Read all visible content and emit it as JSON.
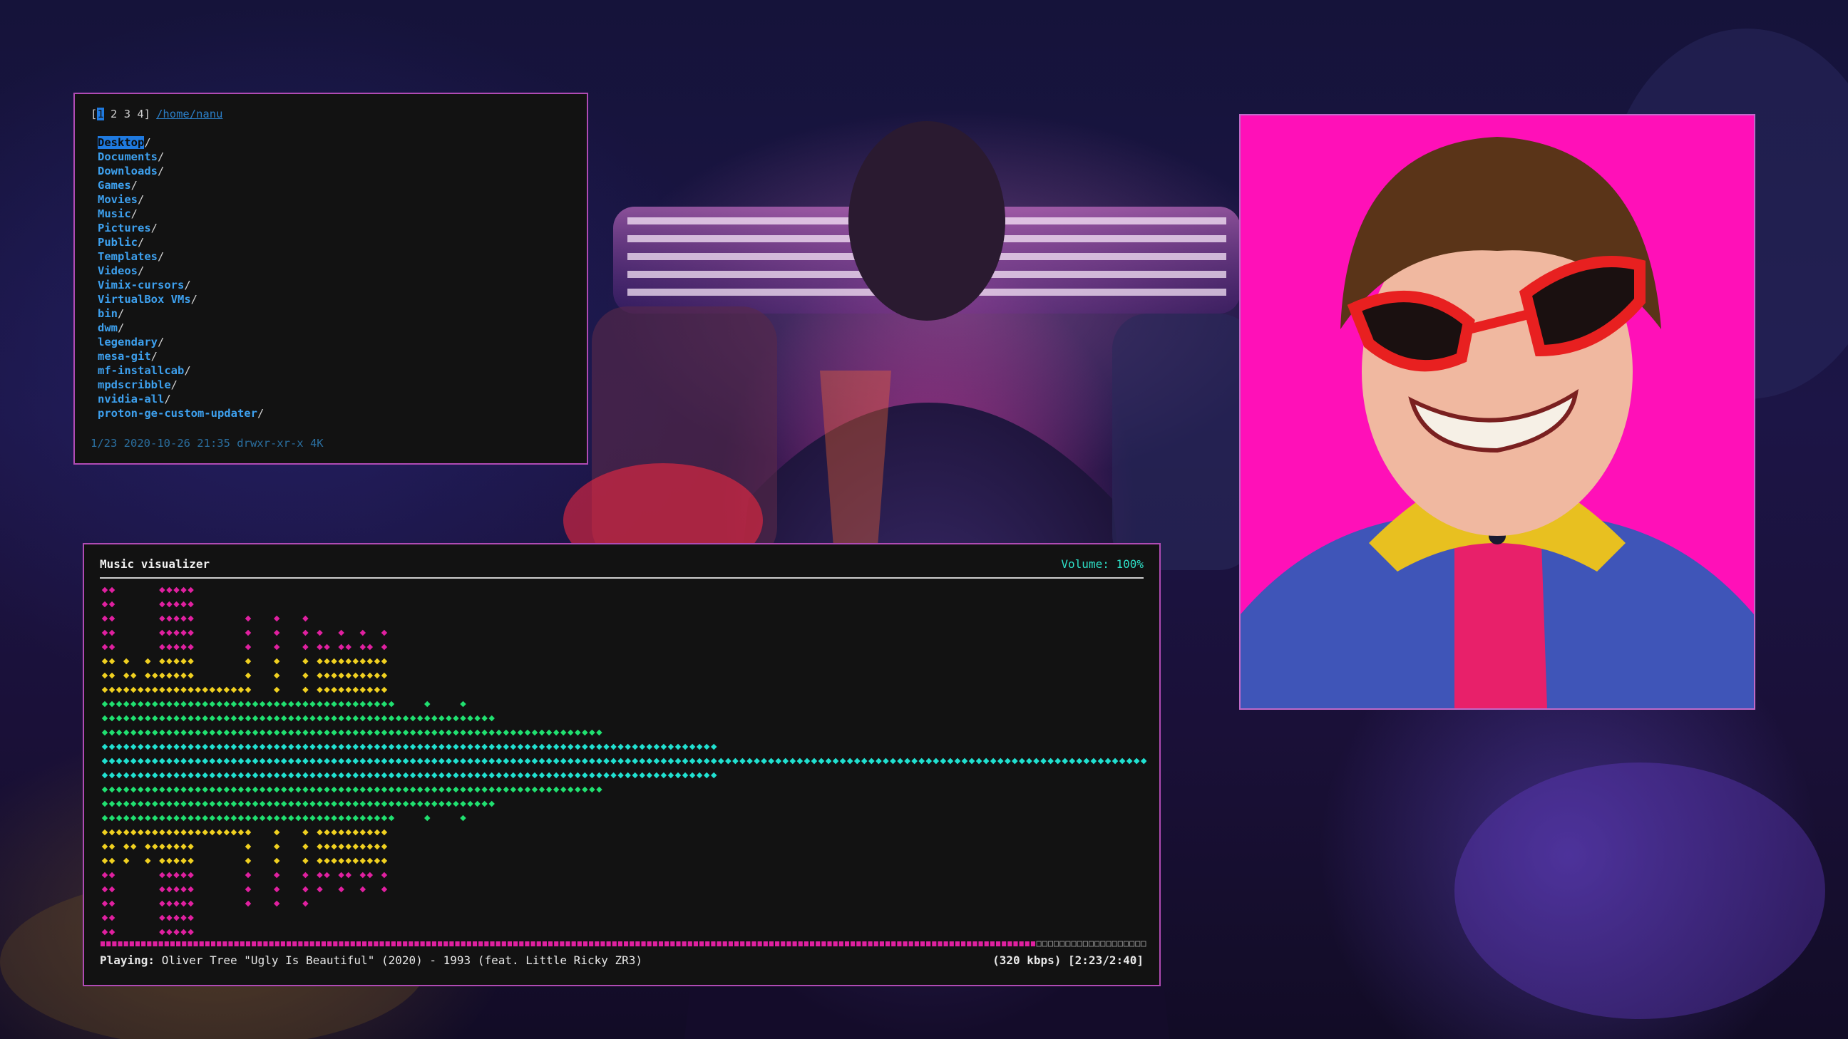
{
  "file_manager": {
    "tabs": [
      "1",
      "2",
      "3",
      "4"
    ],
    "active_tab": "1",
    "path": "/home/nanu",
    "entries": [
      "Desktop",
      "Documents",
      "Downloads",
      "Games",
      "Movies",
      "Music",
      "Pictures",
      "Public",
      "Templates",
      "Videos",
      "Vimix-cursors",
      "VirtualBox VMs",
      "bin",
      "dwm",
      "legendary",
      "mesa-git",
      "mf-installcab",
      "mpdscribble",
      "nvidia-all",
      "proton-ge-custom-updater"
    ],
    "selected": "Desktop",
    "status": "1/23 2020-10-26 21:35 drwxr-xr-x 4K"
  },
  "visualizer": {
    "title": "Music visualizer",
    "volume": "Volume: 100%",
    "playing_label": "Playing:",
    "now_playing": "Oliver Tree \"Ugly Is Beautiful\" (2020) - 1993 (feat. Little Ricky ZR3)",
    "bitrate_time": "(320 kbps) [2:23/2:40]",
    "progress": 0.894,
    "colors": {
      "top": "#e020a0",
      "mid": "#f0d020",
      "low": "#20e070",
      "base": "#20e0d0"
    }
  },
  "album_art": {
    "background": "#ff10b8"
  }
}
